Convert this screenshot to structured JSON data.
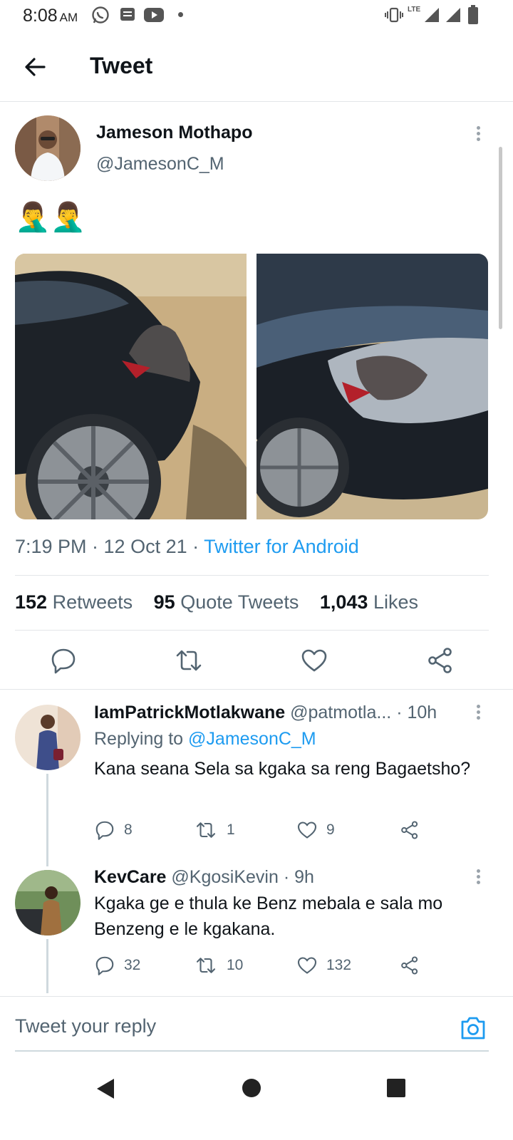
{
  "status_bar": {
    "time": "8:08",
    "ampm": "AM",
    "network": "LTE"
  },
  "header": {
    "title": "Tweet"
  },
  "tweet": {
    "author_name": "Jameson Mothapo",
    "author_handle": "@JamesonC_M",
    "text": "🤦‍♂️🤦‍♂️",
    "timestamp": "7:19 PM · 12 Oct 21 · ",
    "source": "Twitter for Android",
    "stats": {
      "retweets_count": "152",
      "retweets_label": "Retweets",
      "quote_count": "95",
      "quote_label": "Quote Tweets",
      "likes_count": "1,043",
      "likes_label": "Likes"
    }
  },
  "replies": [
    {
      "name": "IamPatrickMotlakwane",
      "handle": "@patmotla...",
      "age": "· 10h",
      "replying_prefix": "Replying to ",
      "replying_to": "@JamesonC_M",
      "text": "Kana seana Sela sa kgaka sa reng Bagaetsho?",
      "reply_count": "8",
      "retweet_count": "1",
      "like_count": "9"
    },
    {
      "name": "KevCare",
      "handle": "@KgosiKevin",
      "age": "· 9h",
      "text": "Kgaka ge e thula ke Benz mebala e sala mo Benzeng e le kgakana.",
      "reply_count": "32",
      "retweet_count": "10",
      "like_count": "132"
    }
  ],
  "composer": {
    "placeholder": "Tweet your reply"
  },
  "colors": {
    "accent": "#1d9bf0",
    "text_primary": "#0f1419",
    "text_secondary": "#536471"
  }
}
